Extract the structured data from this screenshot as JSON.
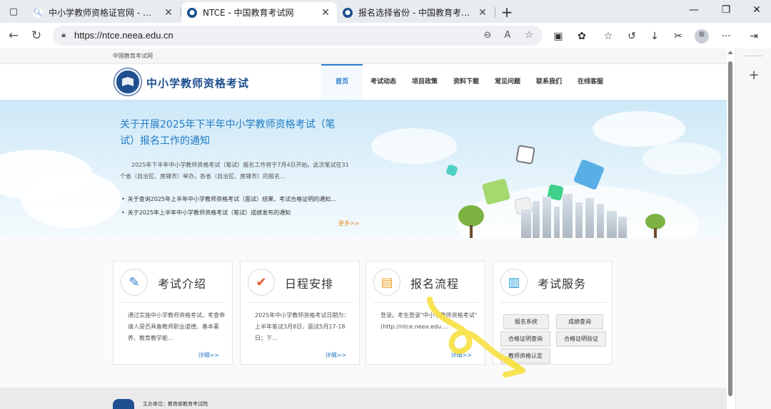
{
  "browser": {
    "tabs": [
      {
        "title": "中小学教师资格证官网 - 搜索",
        "active": false
      },
      {
        "title": "NTCE - 中国教育考试网",
        "active": true
      },
      {
        "title": "报名选择省份 - 中国教育考试网",
        "active": false
      }
    ],
    "url": "https://ntce.neea.edu.cn"
  },
  "site": {
    "strip_text": "中国教育考试网",
    "title": "中小学教师资格考试",
    "nav": [
      "首页",
      "考试动态",
      "项目政策",
      "资料下载",
      "常见问题",
      "联系我们",
      "在线客服"
    ]
  },
  "hero": {
    "title": "关于开展2025年下半年中小学教师资格考试（笔试）报名工作的通知",
    "summary": "2025年下半年中小学教师资格考试（笔试）报名工作将于7月4日开始。此次笔试在31个省（自治区、直辖市）举办。各省（自治区、直辖市）的报名...",
    "links": [
      "关于查询2025年上半年中小学教师资格考试（面试）结果、考试合格证明的通知...",
      "关于2025年上半年中小学教师资格考试（笔试）成绩发布的通知"
    ],
    "more": "更多>>"
  },
  "cards": [
    {
      "title": "考试介绍",
      "text": "通过实施中小学教师资格考试，考查申请人是否具备教师职业道德、基本素养、教育教学能...",
      "more": "详细>>"
    },
    {
      "title": "日程安排",
      "text": "2025年中小学教师资格考试日期为：上半年笔试3月8日，面试5月17-18日；下...",
      "more": "详细>>"
    },
    {
      "title": "报名流程",
      "text": "登录。考生登录\"中小学教师资格考试\"(http://ntce.neea.edu....",
      "more": "详细>>"
    },
    {
      "title": "考试服务",
      "buttons": [
        "报名系统",
        "成绩查询",
        "合格证明查询",
        "合格证明验证",
        "教师资格认定"
      ]
    }
  ],
  "footer": {
    "host": "主办单位：教育部教育考试院"
  },
  "colors": {
    "brand_blue": "#1f4f8f",
    "link_blue": "#2a7dc9",
    "more_orange": "#e08a1e",
    "annotation_yellow": "#f7e14a"
  }
}
